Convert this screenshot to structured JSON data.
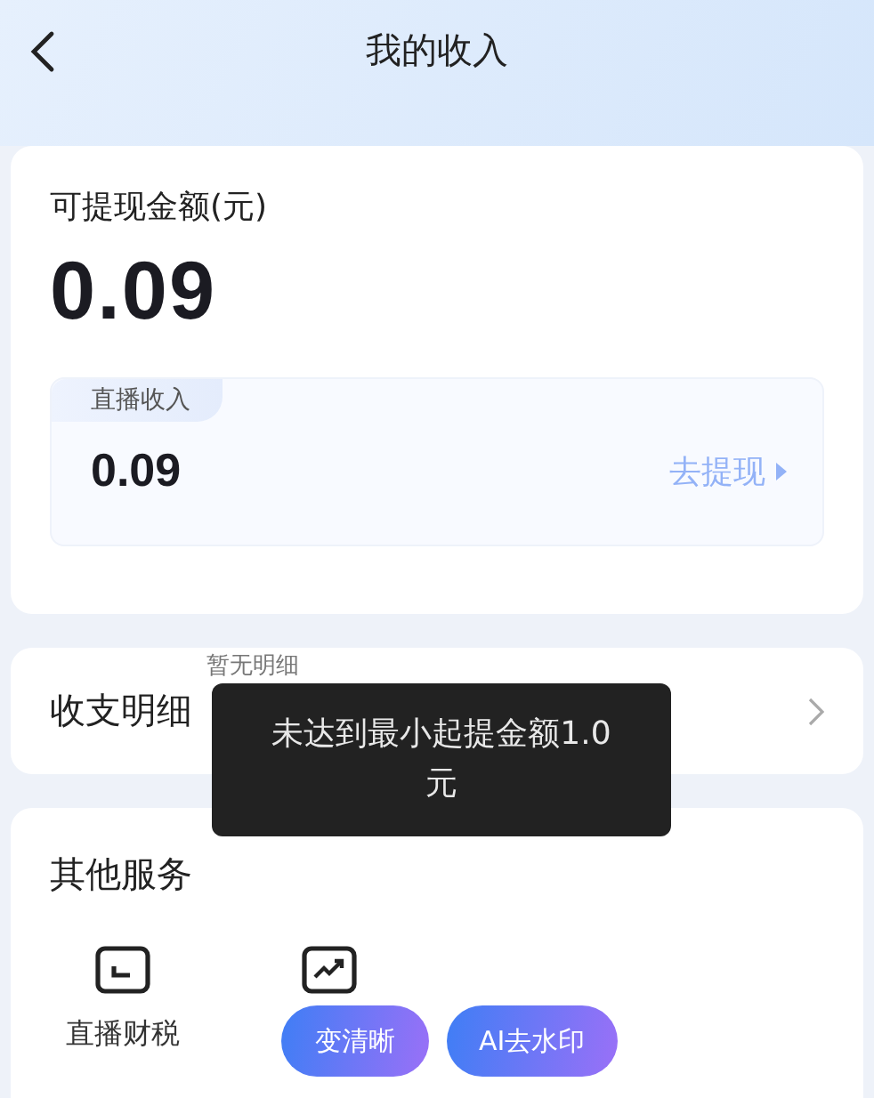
{
  "header": {
    "title": "我的收入"
  },
  "balance": {
    "label": "可提现金额(元)",
    "amount": "0.09",
    "sub": {
      "tag": "直播收入",
      "amount": "0.09",
      "action": "去提现"
    }
  },
  "details": {
    "title": "收支明细",
    "note": "暂无明细"
  },
  "services": {
    "title": "其他服务",
    "items": [
      {
        "label": "直播财税",
        "kind": "tax"
      },
      {
        "kind": "growth"
      }
    ]
  },
  "toast": {
    "message": "未达到最小起提金额1.0元"
  },
  "floating_actions": [
    "变清晰",
    "AI去水印"
  ]
}
